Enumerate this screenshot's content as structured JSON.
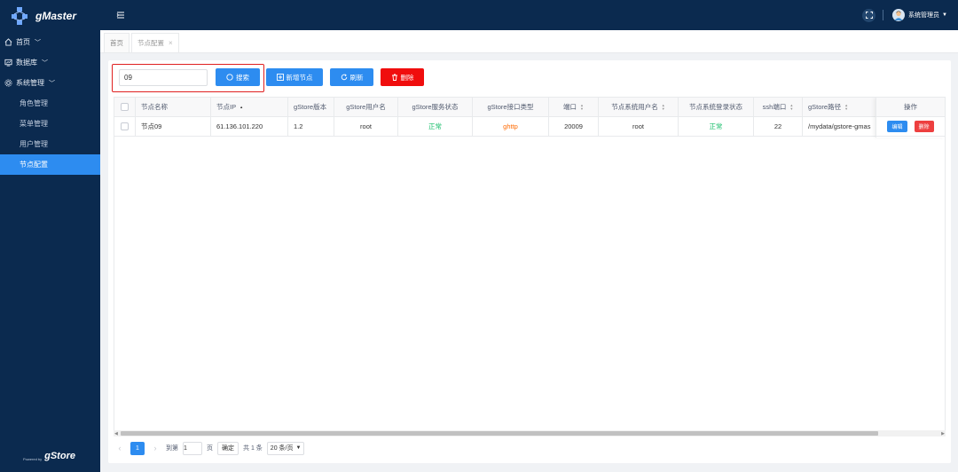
{
  "app": {
    "name": "gMaster"
  },
  "sidebar": {
    "menus": [
      {
        "label": "首页"
      },
      {
        "label": "数据库"
      },
      {
        "label": "系统管理"
      }
    ],
    "items": [
      {
        "label": "角色管理"
      },
      {
        "label": "菜单管理"
      },
      {
        "label": "用户管理"
      },
      {
        "label": "节点配置"
      }
    ],
    "powered_by": "Powered by",
    "powered_brand": "gStore"
  },
  "header": {
    "username": "系统管理员"
  },
  "tabs": [
    {
      "label": "首页"
    },
    {
      "label": "节点配置"
    }
  ],
  "toolbar": {
    "search_value": "09",
    "search_label": "搜索",
    "add_label": "新增节点",
    "refresh_label": "刷新",
    "delete_label": "删除"
  },
  "table": {
    "columns": [
      "节点名称",
      "节点IP",
      "gStore版本",
      "gStore用户名",
      "gStore服务状态",
      "gStore接口类型",
      "端口",
      "节点系统用户名",
      "节点系统登录状态",
      "ssh端口",
      "gStore路径",
      "操作"
    ],
    "rows": [
      {
        "name": "节点09",
        "ip": "61.136.101.220",
        "version": "1.2",
        "user": "root",
        "service_status": "正常",
        "api_type": "ghttp",
        "port": "20009",
        "sys_user": "root",
        "login_status": "正常",
        "ssh_port": "22",
        "path": "/mydata/gstore-gmas",
        "edit": "编辑",
        "delete": "删除"
      }
    ]
  },
  "pager": {
    "page": "1",
    "goto_label": "到第",
    "goto_value": "1",
    "page_unit": "页",
    "confirm_label": "确定",
    "total": "共 1 条",
    "page_size": "20 条/页"
  },
  "colors": {
    "primary": "#2d8cf0",
    "danger": "#f00d0d",
    "sidebar": "#0b2a4f",
    "success": "#19be6b",
    "warning": "#ff6a00"
  }
}
